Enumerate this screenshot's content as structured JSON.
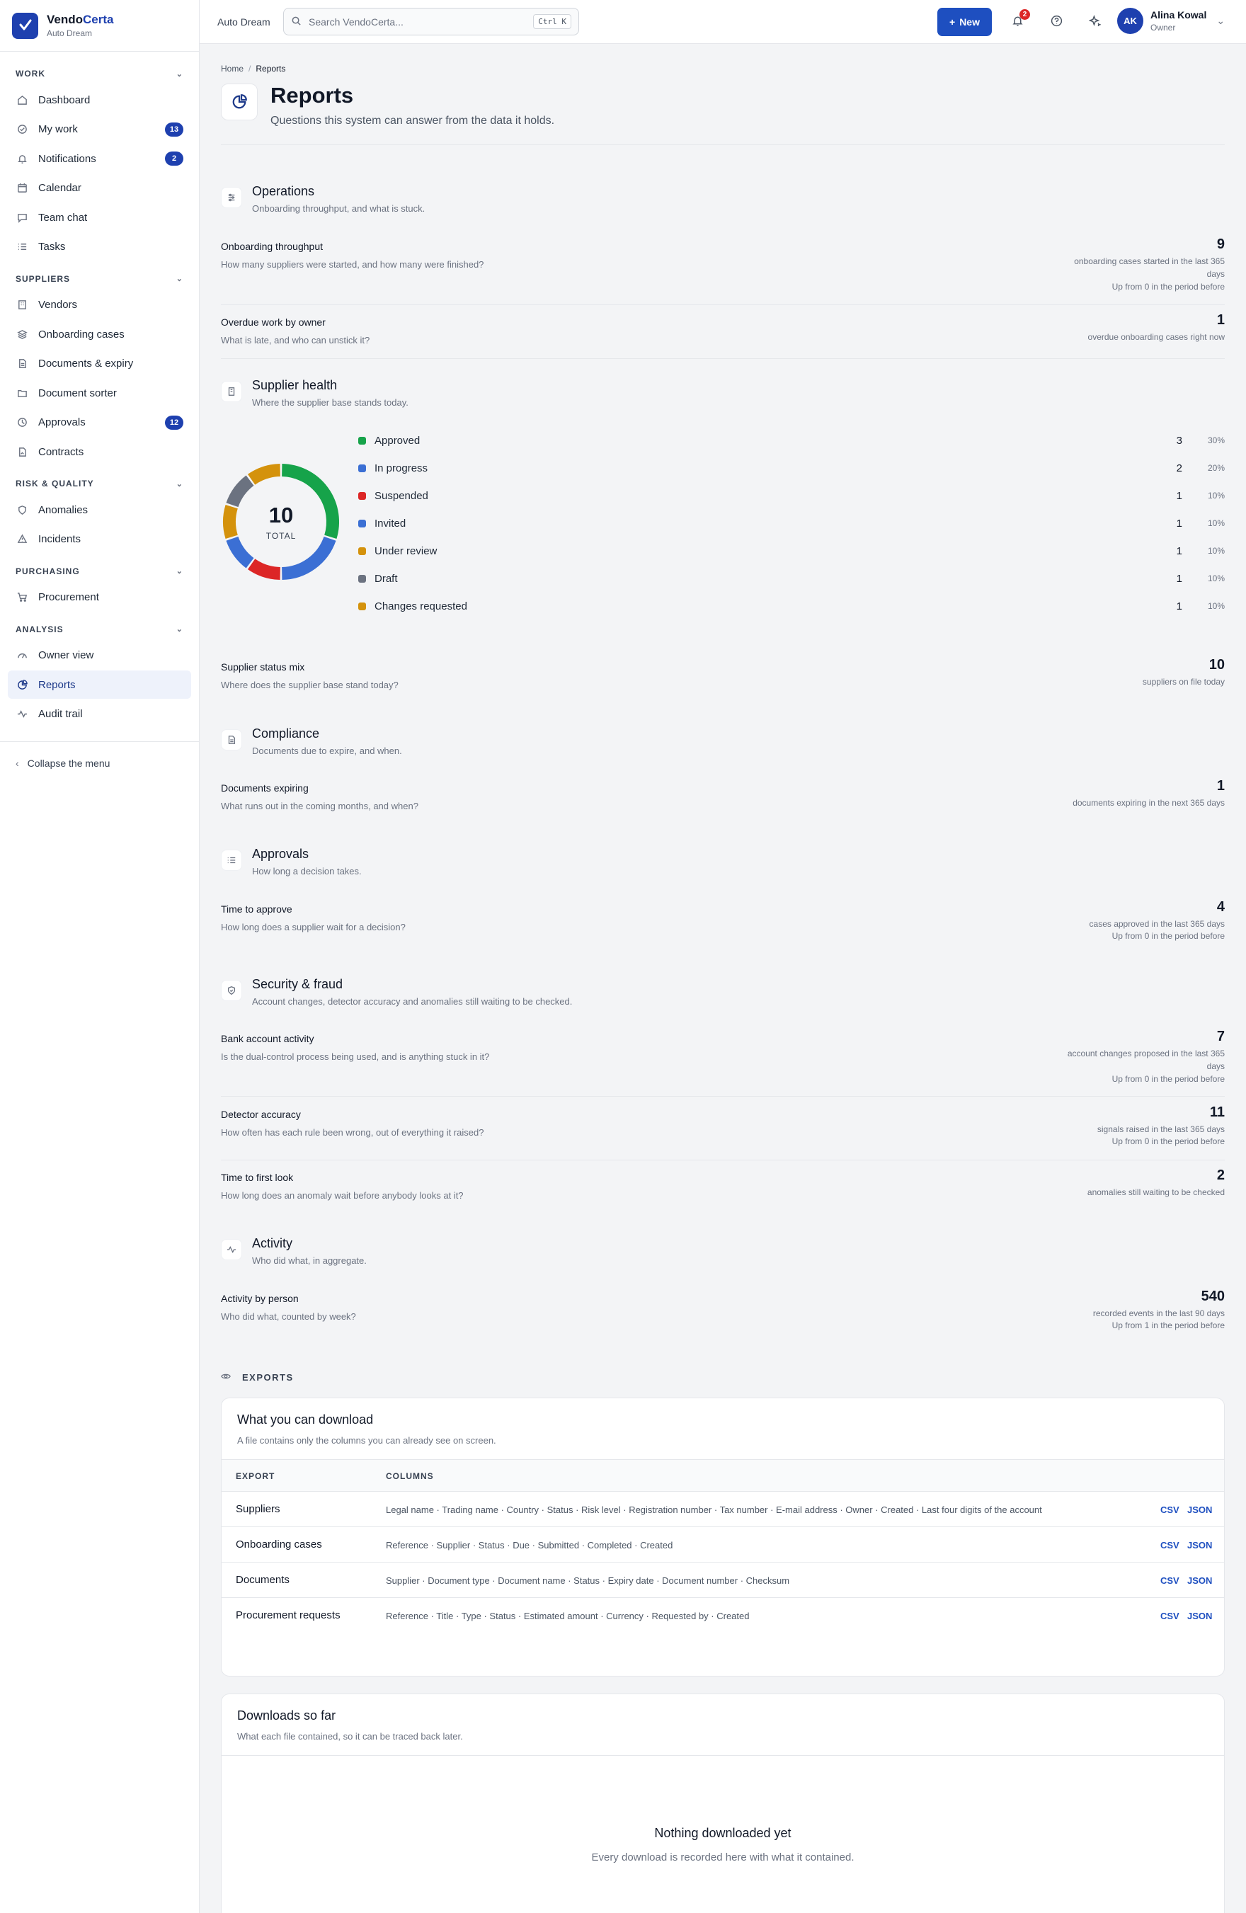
{
  "brand": {
    "name_main": "Vendo",
    "name_accent": "Certa",
    "workspace": "Auto Dream"
  },
  "colors": {
    "primary": "#1e40af",
    "approved": "#16a34a",
    "in_progress": "#3b6fd4",
    "suspended": "#dc2626",
    "invited": "#3b6fd4",
    "under_review": "#d4920c",
    "draft": "#6b7280",
    "changes_requested": "#d4920c"
  },
  "sidebar": {
    "sections": [
      {
        "label": "WORK",
        "items": [
          {
            "label": "Dashboard",
            "icon": "home-icon"
          },
          {
            "label": "My work",
            "icon": "check-circle-icon",
            "badge": "13"
          },
          {
            "label": "Notifications",
            "icon": "bell-icon",
            "badge": "2"
          },
          {
            "label": "Calendar",
            "icon": "calendar-icon"
          },
          {
            "label": "Team chat",
            "icon": "chat-icon"
          },
          {
            "label": "Tasks",
            "icon": "list-icon"
          }
        ]
      },
      {
        "label": "SUPPLIERS",
        "items": [
          {
            "label": "Vendors",
            "icon": "building-icon"
          },
          {
            "label": "Onboarding cases",
            "icon": "layers-icon"
          },
          {
            "label": "Documents & expiry",
            "icon": "file-icon"
          },
          {
            "label": "Document sorter",
            "icon": "folder-icon"
          },
          {
            "label": "Approvals",
            "icon": "clock-icon",
            "badge": "12"
          },
          {
            "label": "Contracts",
            "icon": "contract-icon"
          }
        ]
      },
      {
        "label": "RISK & QUALITY",
        "items": [
          {
            "label": "Anomalies",
            "icon": "shield-icon"
          },
          {
            "label": "Incidents",
            "icon": "warning-icon"
          }
        ]
      },
      {
        "label": "PURCHASING",
        "items": [
          {
            "label": "Procurement",
            "icon": "cart-icon"
          }
        ]
      },
      {
        "label": "ANALYSIS",
        "items": [
          {
            "label": "Owner view",
            "icon": "gauge-icon"
          },
          {
            "label": "Reports",
            "icon": "pie-icon",
            "active": true
          },
          {
            "label": "Audit trail",
            "icon": "activity-icon"
          }
        ]
      }
    ],
    "collapse_label": "Collapse the menu"
  },
  "topbar": {
    "workspace": "Auto Dream",
    "search_placeholder": "Search VendoCerta...",
    "search_shortcut": "Ctrl K",
    "new_label": "New",
    "notif_count": "2",
    "user": {
      "initials": "AK",
      "name": "Alina Kowal",
      "role": "Owner"
    }
  },
  "page": {
    "breadcrumb_home": "Home",
    "breadcrumb_current": "Reports",
    "title": "Reports",
    "subtitle": "Questions this system can answer from the data it holds."
  },
  "sections": {
    "operations": {
      "title": "Operations",
      "sub": "Onboarding throughput, and what is stuck."
    },
    "health": {
      "title": "Supplier health",
      "sub": "Where the supplier base stands today."
    },
    "compliance": {
      "title": "Compliance",
      "sub": "Documents due to expire, and when."
    },
    "approvals": {
      "title": "Approvals",
      "sub": "How long a decision takes."
    },
    "security": {
      "title": "Security & fraud",
      "sub": "Account changes, detector accuracy and anomalies still waiting to be checked."
    },
    "activity": {
      "title": "Activity",
      "sub": "Who did what, in aggregate."
    }
  },
  "metrics": {
    "throughput": {
      "title": "Onboarding throughput",
      "q": "How many suppliers were started, and how many were finished?",
      "value": "9",
      "caption": "onboarding cases started in the last 365 days",
      "compare": "Up from 0 in the period before"
    },
    "overdue": {
      "title": "Overdue work by owner",
      "q": "What is late, and who can unstick it?",
      "value": "1",
      "caption": "overdue onboarding cases right now"
    },
    "status_mix": {
      "title": "Supplier status mix",
      "q": "Where does the supplier base stand today?",
      "value": "10",
      "caption": "suppliers on file today"
    },
    "expiring": {
      "title": "Documents expiring",
      "q": "What runs out in the coming months, and when?",
      "value": "1",
      "caption": "documents expiring in the next 365 days"
    },
    "approve_time": {
      "title": "Time to approve",
      "q": "How long does a supplier wait for a decision?",
      "value": "4",
      "caption": "cases approved in the last 365 days",
      "compare": "Up from 0 in the period before"
    },
    "bank": {
      "title": "Bank account activity",
      "q": "Is the dual-control process being used, and is anything stuck in it?",
      "value": "7",
      "caption": "account changes proposed in the last 365 days",
      "compare": "Up from 0 in the period before"
    },
    "detector": {
      "title": "Detector accuracy",
      "q": "How often has each rule been wrong, out of everything it raised?",
      "value": "11",
      "caption": "signals raised in the last 365 days",
      "compare": "Up from 0 in the period before"
    },
    "first_look": {
      "title": "Time to first look",
      "q": "How long does an anomaly wait before anybody looks at it?",
      "value": "2",
      "caption": "anomalies still waiting to be checked"
    },
    "activity_person": {
      "title": "Activity by person",
      "q": "Who did what, counted by week?",
      "value": "540",
      "caption": "recorded events in the last 90 days",
      "compare": "Up from 1 in the period before"
    }
  },
  "chart_data": {
    "type": "pie",
    "total": "10",
    "total_label": "TOTAL",
    "categories": [
      "Approved",
      "In progress",
      "Suspended",
      "Invited",
      "Under review",
      "Draft",
      "Changes requested"
    ],
    "values": [
      3,
      2,
      1,
      1,
      1,
      1,
      1
    ],
    "percents": [
      "30%",
      "20%",
      "10%",
      "10%",
      "10%",
      "10%",
      "10%"
    ],
    "colors": [
      "#16a34a",
      "#3b6fd4",
      "#dc2626",
      "#3b6fd4",
      "#d4920c",
      "#6b7280",
      "#d4920c"
    ]
  },
  "exports": {
    "label": "EXPORTS",
    "card_title": "What you can download",
    "card_sub": "A file contains only the columns you can already see on screen.",
    "col_export": "EXPORT",
    "col_columns": "COLUMNS",
    "rows": [
      {
        "name": "Suppliers",
        "columns": "Legal name · Trading name · Country · Status · Risk level · Registration number · Tax number · E-mail address · Owner · Created · Last four digits of the account",
        "csv": "CSV",
        "json": "JSON"
      },
      {
        "name": "Onboarding cases",
        "columns": "Reference · Supplier · Status · Due · Submitted · Completed · Created",
        "csv": "CSV",
        "json": "JSON"
      },
      {
        "name": "Documents",
        "columns": "Supplier · Document type · Document name · Status · Expiry date · Document number · Checksum",
        "csv": "CSV",
        "json": "JSON"
      },
      {
        "name": "Procurement requests",
        "columns": "Reference · Title · Type · Status · Estimated amount · Currency · Requested by · Created",
        "csv": "CSV",
        "json": "JSON"
      }
    ]
  },
  "downloads": {
    "title": "Downloads so far",
    "sub": "What each file contained, so it can be traced back later.",
    "empty_title": "Nothing downloaded yet",
    "empty_sub": "Every download is recorded here with what it contained."
  }
}
